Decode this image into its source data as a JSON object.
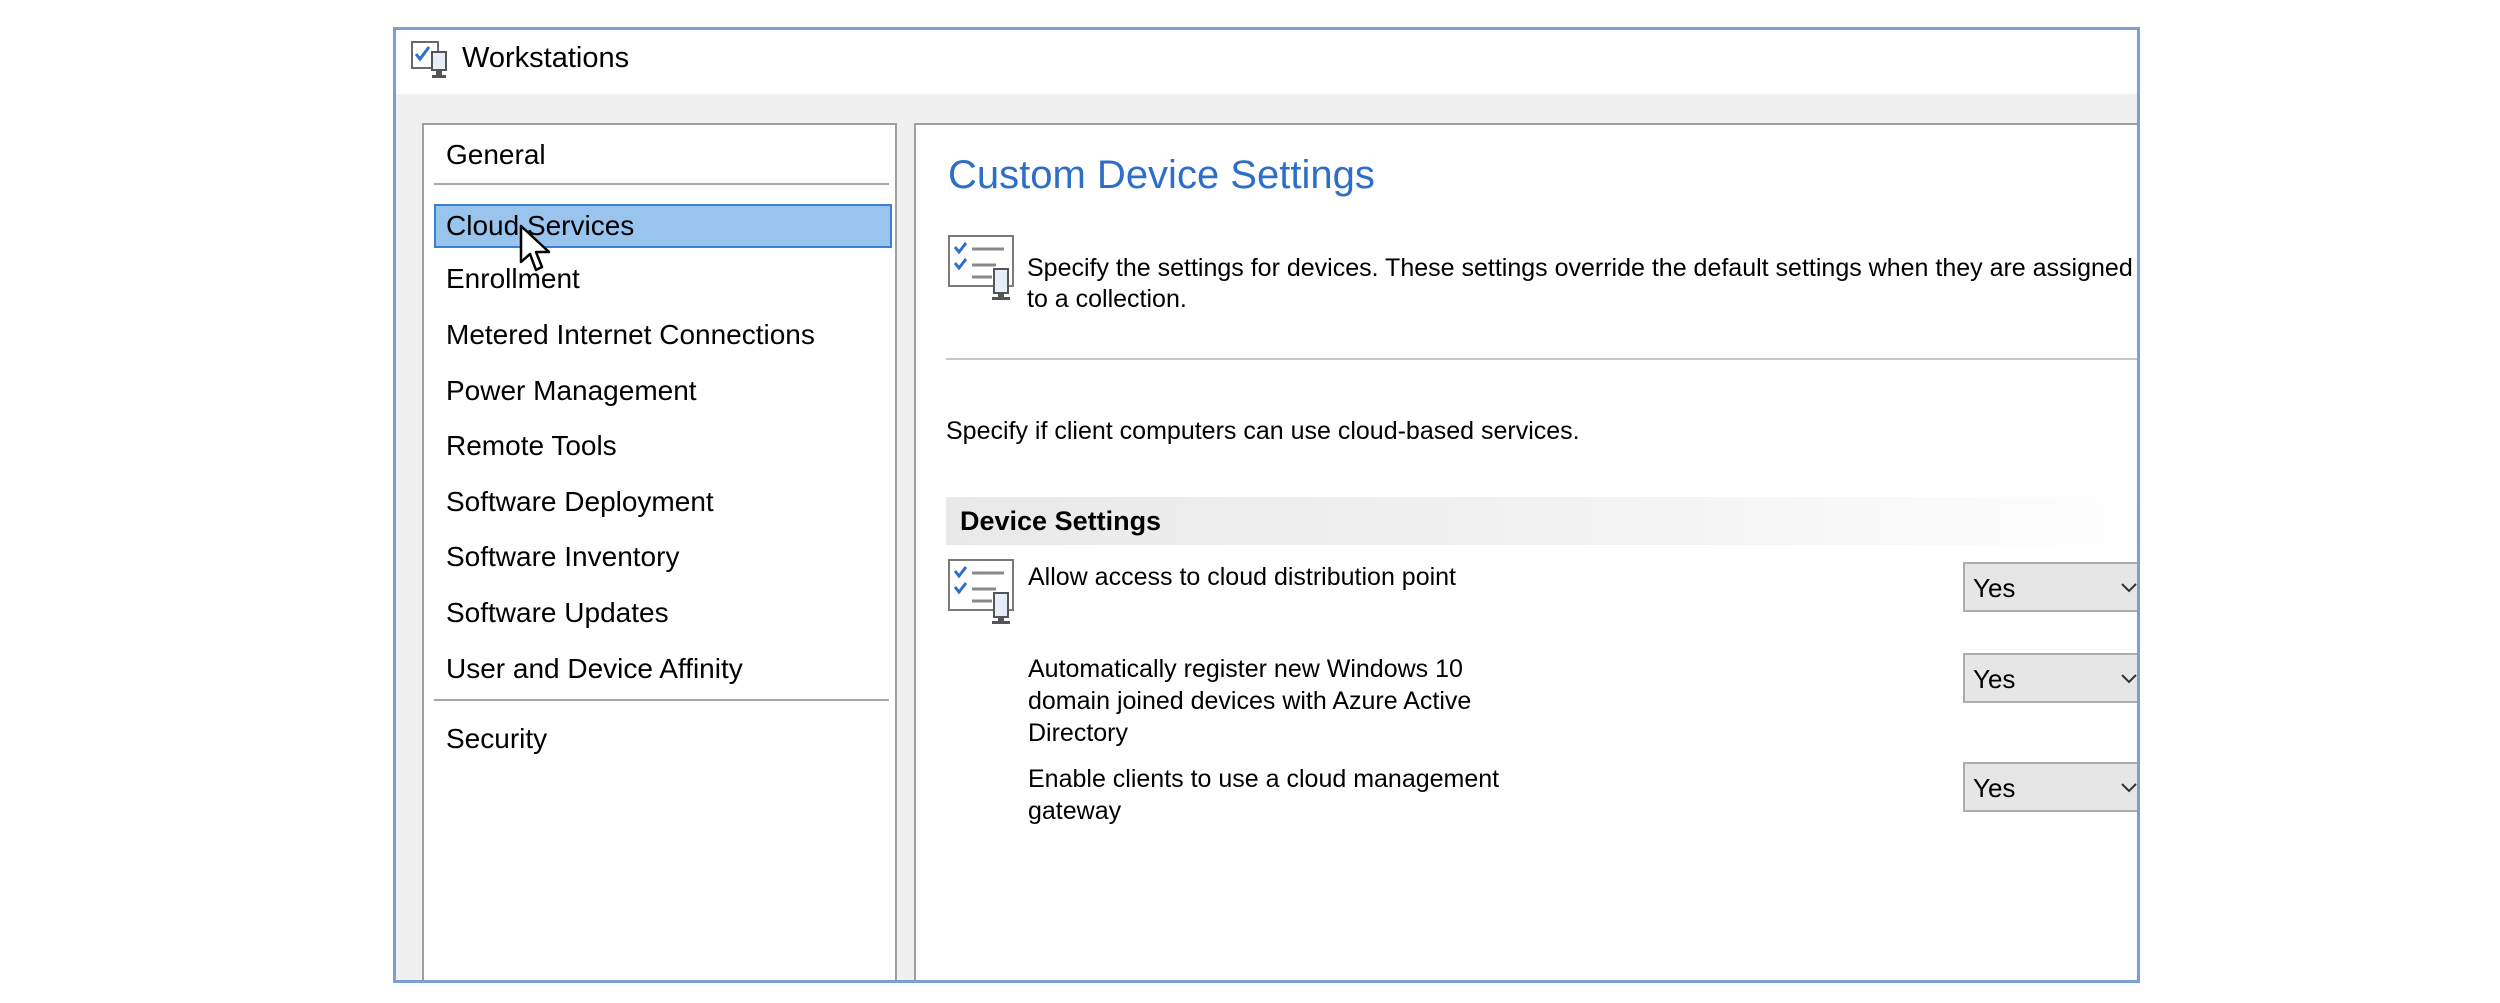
{
  "window": {
    "title": "Workstations"
  },
  "nav": {
    "items": [
      {
        "label": "General"
      },
      {
        "label": "Cloud Services"
      },
      {
        "label": "Enrollment"
      },
      {
        "label": "Metered Internet Connections"
      },
      {
        "label": "Power Management"
      },
      {
        "label": "Remote Tools"
      },
      {
        "label": "Software Deployment"
      },
      {
        "label": "Software Inventory"
      },
      {
        "label": "Software Updates"
      },
      {
        "label": "User and Device Affinity"
      },
      {
        "label": "Security"
      }
    ],
    "selected_index": 1
  },
  "main": {
    "title": "Custom Device Settings",
    "description": "Specify the settings for devices. These settings override the default settings when they are assigned to a collection.",
    "intro": "Specify if client computers can use cloud-based services.",
    "section_header": "Device Settings",
    "settings": [
      {
        "label": "Allow access to cloud distribution point",
        "value": "Yes"
      },
      {
        "label": "Automatically register new Windows 10 domain joined devices with Azure Active Directory",
        "value": "Yes"
      },
      {
        "label": "Enable clients to use a cloud management gateway",
        "value": "Yes"
      }
    ]
  },
  "colors": {
    "accent_title": "#2d6fc8",
    "selection_fill": "#99c4ee",
    "selection_border": "#3b7fd0",
    "window_border": "#7a9fd0"
  },
  "icons": {
    "window": "workstation-settings-icon",
    "description": "checklist-settings-icon",
    "settings": "checklist-settings-icon",
    "dropdown": "chevron-down-icon",
    "cursor": "mouse-pointer-icon"
  }
}
